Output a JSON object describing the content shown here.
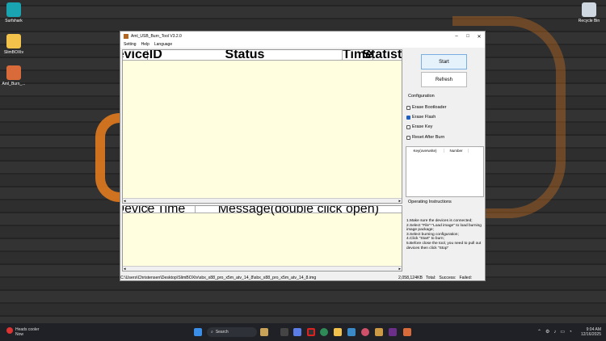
{
  "desktop": {
    "icons": [
      {
        "label": "Surfshark"
      },
      {
        "label": "SlimBOXtv"
      },
      {
        "label": "Aml_Burn_..."
      },
      {
        "label": "Recycle Bin"
      }
    ]
  },
  "window": {
    "title": "Aml_USB_Burn_Tool V3.2.0",
    "menu": [
      "Setting",
      "Help",
      "Language"
    ],
    "device_table": {
      "columns": [
        "DeviceID",
        "Status",
        "Time",
        "Statistic"
      ]
    },
    "message_table": {
      "columns": [
        "Device",
        "Time",
        "Message(double click open)"
      ]
    },
    "start_label": "Start",
    "refresh_label": "Refresh",
    "configuration_label": "Configuration",
    "options": [
      {
        "label": "Erase Bootloader",
        "checked": false
      },
      {
        "label": "Erase Flash",
        "checked": true
      },
      {
        "label": "Erase Key",
        "checked": false
      },
      {
        "label": "Reset After Burn",
        "checked": false
      }
    ],
    "key_table": {
      "columns": [
        "Key(overwrite)",
        "Number"
      ]
    },
    "instructions_label": "Operating Instructions",
    "instructions": [
      "1.Make sure the devices is connected;",
      "2.Select \"File\"-\"Load image\" to load burning image package;",
      "3.Select burning configuration;",
      "4.Click \"Start\" to burn;",
      "5.Before close the tool, you need to pull out devices then click \"Stop\""
    ],
    "status": {
      "path": "C:\\Users\\Christensen\\Desktop\\SlimBOXtv\\sbx_x88_pro_x5m_atv_14_8\\sbx_x88_pro_x5m_atv_14_8.img",
      "size": "2,058,124KB",
      "total": "Total:",
      "success": "Success:",
      "failed": "Failed:"
    }
  },
  "taskbar": {
    "weather": "Heads cooler",
    "weather_sub": "Now",
    "search_placeholder": "Search",
    "time": "9:04 AM",
    "date": "12/16/2025"
  },
  "colors": {
    "accent": "#e07a1e",
    "table_bg": "#ffffe0",
    "checkbox": "#1f5fbf"
  }
}
